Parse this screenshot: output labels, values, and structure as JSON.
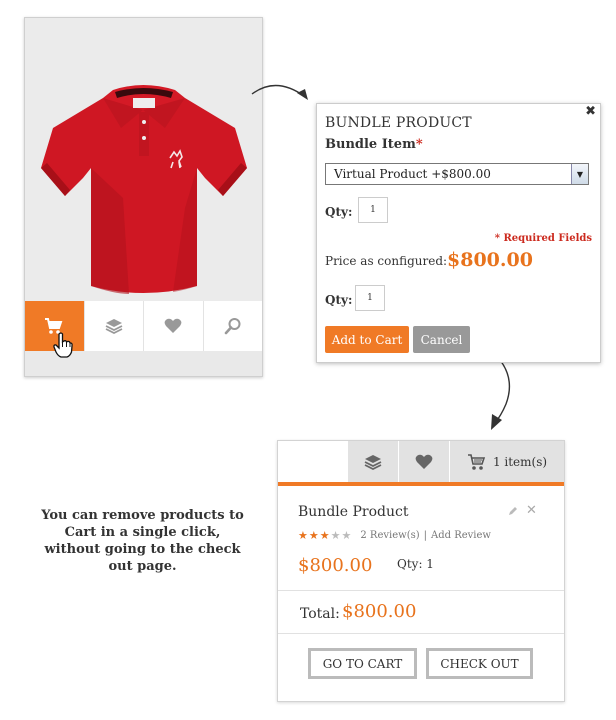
{
  "product_card": {
    "actions": [
      {
        "icon": "cart-icon",
        "active": true
      },
      {
        "icon": "layers-icon",
        "active": false
      },
      {
        "icon": "heart-icon",
        "active": false
      },
      {
        "icon": "search-icon",
        "active": false
      }
    ]
  },
  "popup": {
    "title": "BUNDLE PRODUCT",
    "close_label": "✖",
    "bundle_label": "Bundle Item",
    "required_star": "*",
    "select_value": "Virtual Product   +$800.00",
    "qty_label": "Qty:",
    "qty1_value": "1",
    "required_note": "* Required Fields",
    "price_label": "Price as configured:",
    "price_value": "$800.00",
    "qty2_value": "1",
    "add_to_cart_label": "Add to Cart",
    "cancel_label": "Cancel"
  },
  "description": "You can remove products to Cart in a single click, without going to the check out page.",
  "cart": {
    "items_count": "1 item(s)",
    "product_name": "Bundle Product",
    "rating": 3,
    "rating_max": 5,
    "reviews": "2 Review(s)",
    "review_separator": "|",
    "add_review": "Add Review",
    "price": "$800.00",
    "qty": "Qty: 1",
    "total_label": "Total:",
    "total_value": "$800.00",
    "go_to_cart_label": "GO TO CART",
    "checkout_label": "CHECK OUT",
    "remove_label": "✕"
  },
  "colors": {
    "accent": "#f07a26",
    "price": "#e8731d",
    "required": "#cc2a1e"
  }
}
